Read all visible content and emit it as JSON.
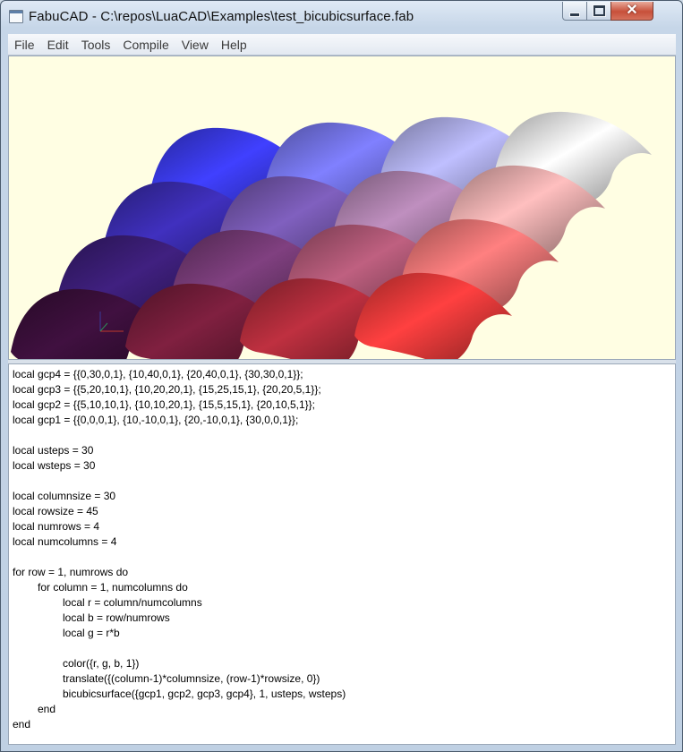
{
  "window": {
    "title": "FabuCAD - C:\\repos\\LuaCAD\\Examples\\test_bicubicsurface.fab",
    "icon": "app-window-icon",
    "controls": [
      "minimize-icon",
      "maximize-icon",
      "close-icon"
    ]
  },
  "menu": {
    "items": [
      "File",
      "Edit",
      "Tools",
      "Compile",
      "View",
      "Help"
    ]
  },
  "viewport": {
    "background": "#fffee3",
    "grid_rows": 4,
    "grid_columns": 4,
    "axis_colors": {
      "x": "#c0392b",
      "y": "#3a3a9a"
    }
  },
  "editor": {
    "lines": [
      {
        "indent": 0,
        "text": "local gcp4 = {{0,30,0,1}, {10,40,0,1}, {20,40,0,1}, {30,30,0,1}};"
      },
      {
        "indent": 0,
        "text": "local gcp3 = {{5,20,10,1}, {10,20,20,1}, {15,25,15,1}, {20,20,5,1}};"
      },
      {
        "indent": 0,
        "text": "local gcp2 = {{5,10,10,1}, {10,10,20,1}, {15,5,15,1}, {20,10,5,1}};"
      },
      {
        "indent": 0,
        "text": "local gcp1 = {{0,0,0,1}, {10,-10,0,1}, {20,-10,0,1}, {30,0,0,1}};"
      },
      {
        "indent": 0,
        "text": ""
      },
      {
        "indent": 0,
        "text": "local usteps = 30"
      },
      {
        "indent": 0,
        "text": "local wsteps = 30"
      },
      {
        "indent": 0,
        "text": ""
      },
      {
        "indent": 0,
        "text": "local columnsize = 30"
      },
      {
        "indent": 0,
        "text": "local rowsize = 45"
      },
      {
        "indent": 0,
        "text": "local numrows = 4"
      },
      {
        "indent": 0,
        "text": "local numcolumns = 4"
      },
      {
        "indent": 0,
        "text": ""
      },
      {
        "indent": 0,
        "text": "for row = 1, numrows do"
      },
      {
        "indent": 1,
        "text": "for column = 1, numcolumns do"
      },
      {
        "indent": 2,
        "text": "local r = column/numcolumns"
      },
      {
        "indent": 2,
        "text": "local b = row/numrows"
      },
      {
        "indent": 2,
        "text": "local g = r*b"
      },
      {
        "indent": 2,
        "text": ""
      },
      {
        "indent": 2,
        "text": "color({r, g, b, 1})"
      },
      {
        "indent": 2,
        "text": "translate({(column-1)*columnsize, (row-1)*rowsize, 0})"
      },
      {
        "indent": 2,
        "text": "bicubicsurface({gcp1, gcp2, gcp3, gcp4}, 1, usteps, wsteps)"
      },
      {
        "indent": 1,
        "text": "end"
      },
      {
        "indent": 0,
        "text": "end"
      }
    ]
  }
}
